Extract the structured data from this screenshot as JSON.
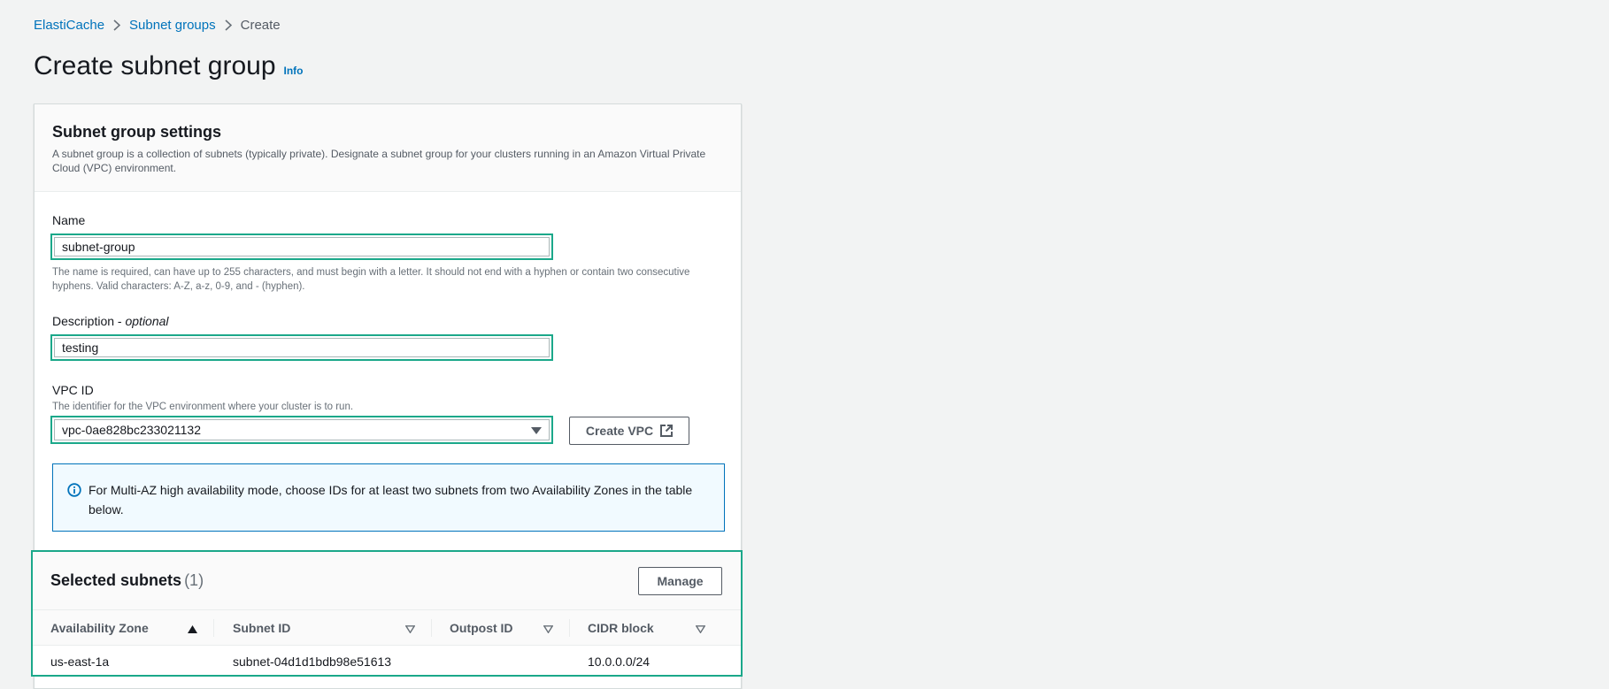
{
  "breadcrumb": {
    "items": [
      "ElastiCache",
      "Subnet groups"
    ],
    "current": "Create"
  },
  "page": {
    "title": "Create subnet group",
    "info": "Info"
  },
  "settings": {
    "title": "Subnet group settings",
    "description": "A subnet group is a collection of subnets (typically private). Designate a subnet group for your clusters running in an Amazon Virtual Private Cloud (VPC) environment.",
    "name_label": "Name",
    "name_value": "subnet-group",
    "name_hint": "The name is required, can have up to 255 characters, and must begin with a letter. It should not end with a hyphen or contain two consecutive hyphens. Valid characters: A-Z, a-z, 0-9, and - (hyphen).",
    "description_label": "Description -",
    "description_optional": "optional",
    "description_value": "testing",
    "vpc_label": "VPC ID",
    "vpc_hint": "The identifier for the VPC environment where your cluster is to run.",
    "vpc_value": "vpc-0ae828bc233021132",
    "create_vpc_label": "Create VPC",
    "alert_text": "For Multi-AZ high availability mode, choose IDs for at least two subnets from two Availability Zones in the table below."
  },
  "subnets": {
    "title": "Selected subnets",
    "count": "(1)",
    "manage_label": "Manage",
    "columns": [
      "Availability Zone",
      "Subnet ID",
      "Outpost ID",
      "CIDR block"
    ],
    "rows": [
      {
        "az": "us-east-1a",
        "subnet_id": "subnet-04d1d1bdb98e51613",
        "outpost_id": "",
        "cidr": "10.0.0.0/24"
      }
    ]
  },
  "colors": {
    "link": "#0073bb",
    "highlight": "#1ba88a",
    "alert_bg": "#f1faff"
  }
}
